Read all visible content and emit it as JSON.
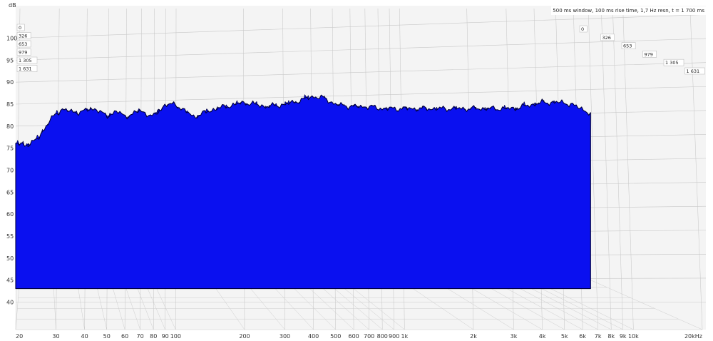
{
  "chart_data": {
    "type": "waterfall",
    "info_text": "500 ms window, 100 ms rise time,  1,7 Hz resn, t = 1 700 ms",
    "ylabel": "dB",
    "y_ticks": [
      100,
      95,
      90,
      85,
      80,
      75,
      70,
      65,
      60,
      55,
      50,
      45,
      40
    ],
    "ylim": [
      37,
      103
    ],
    "x_unit": "Hz",
    "x_scale": "log",
    "xlim": [
      20,
      20000
    ],
    "x_ticks": [
      {
        "value": 20,
        "label": "20"
      },
      {
        "value": 30,
        "label": "30"
      },
      {
        "value": 40,
        "label": "40"
      },
      {
        "value": 50,
        "label": "50"
      },
      {
        "value": 60,
        "label": "60"
      },
      {
        "value": 70,
        "label": "70"
      },
      {
        "value": 80,
        "label": "80"
      },
      {
        "value": 90,
        "label": "90"
      },
      {
        "value": 100,
        "label": "100"
      },
      {
        "value": 200,
        "label": "200"
      },
      {
        "value": 300,
        "label": "300"
      },
      {
        "value": 400,
        "label": "400"
      },
      {
        "value": 500,
        "label": "500"
      },
      {
        "value": 600,
        "label": "600"
      },
      {
        "value": 700,
        "label": "700"
      },
      {
        "value": 800,
        "label": "800"
      },
      {
        "value": 900,
        "label": "900"
      },
      {
        "value": 1000,
        "label": "1k"
      },
      {
        "value": 2000,
        "label": "2k"
      },
      {
        "value": 3000,
        "label": "3k"
      },
      {
        "value": 4000,
        "label": "4k"
      },
      {
        "value": 5000,
        "label": "5k"
      },
      {
        "value": 6000,
        "label": "6k"
      },
      {
        "value": 7000,
        "label": "7k"
      },
      {
        "value": 8000,
        "label": "8k"
      },
      {
        "value": 9000,
        "label": "9k"
      },
      {
        "value": 10000,
        "label": "10k"
      },
      {
        "value": 20000,
        "label": "20kHz"
      }
    ],
    "time_slices": [
      {
        "label": "0"
      },
      {
        "label": "326"
      },
      {
        "label": "653"
      },
      {
        "label": "979"
      },
      {
        "label": "1 305"
      },
      {
        "label": "1 631"
      }
    ],
    "frequency_range_hz": [
      20,
      6500
    ],
    "front_envelope": [
      {
        "f": 20,
        "db": 82.5
      },
      {
        "f": 22,
        "db": 82
      },
      {
        "f": 25,
        "db": 83.5
      },
      {
        "f": 28,
        "db": 88
      },
      {
        "f": 32,
        "db": 91
      },
      {
        "f": 36,
        "db": 90
      },
      {
        "f": 40,
        "db": 90.5
      },
      {
        "f": 45,
        "db": 91
      },
      {
        "f": 50,
        "db": 89
      },
      {
        "f": 55,
        "db": 90.5
      },
      {
        "f": 60,
        "db": 89
      },
      {
        "f": 70,
        "db": 90.5
      },
      {
        "f": 80,
        "db": 89
      },
      {
        "f": 90,
        "db": 92
      },
      {
        "f": 100,
        "db": 92
      },
      {
        "f": 120,
        "db": 89
      },
      {
        "f": 150,
        "db": 91
      },
      {
        "f": 200,
        "db": 92.5
      },
      {
        "f": 250,
        "db": 91.5
      },
      {
        "f": 300,
        "db": 92
      },
      {
        "f": 350,
        "db": 93
      },
      {
        "f": 400,
        "db": 94
      },
      {
        "f": 450,
        "db": 93.5
      },
      {
        "f": 500,
        "db": 92
      },
      {
        "f": 600,
        "db": 91.5
      },
      {
        "f": 700,
        "db": 91.5
      },
      {
        "f": 800,
        "db": 91
      },
      {
        "f": 1000,
        "db": 91
      },
      {
        "f": 1500,
        "db": 91
      },
      {
        "f": 2000,
        "db": 91
      },
      {
        "f": 3000,
        "db": 91
      },
      {
        "f": 4000,
        "db": 92.5
      },
      {
        "f": 5000,
        "db": 92.5
      },
      {
        "f": 6000,
        "db": 91
      },
      {
        "f": 6500,
        "db": 89.5
      }
    ],
    "floor_db": 48,
    "colors": {
      "fill": "#0a10f0",
      "edge": "#00003a",
      "grid": "#c8c8c8",
      "background": "#f4f4f4"
    }
  }
}
